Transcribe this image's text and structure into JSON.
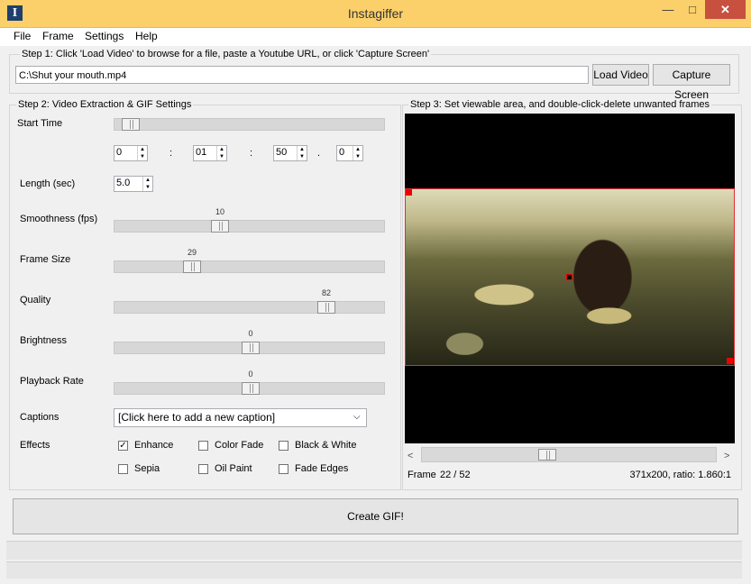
{
  "window": {
    "title": "Instagiffer",
    "icon_letter": "I",
    "minimize": "—",
    "maximize": "□",
    "close": "✕"
  },
  "menu": [
    "File",
    "Frame",
    "Settings",
    "Help"
  ],
  "step1": {
    "label": "Step 1: Click 'Load Video' to browse for a file, paste a Youtube URL, or click 'Capture Screen'",
    "file_path": "C:\\Shut your mouth.mp4",
    "load_video": "Load Video",
    "capture_screen": "Capture Screen"
  },
  "step2": {
    "label": "Step 2: Video Extraction & GIF Settings",
    "start_time": {
      "label": "Start Time",
      "position": 0.03,
      "hours": "0",
      "minutes": "01",
      "seconds": "50",
      "millis": "0",
      "sep1": ":",
      "sep2": ":",
      "sep3": "."
    },
    "length": {
      "label": "Length (sec)",
      "value": "5.0"
    },
    "sliders": [
      {
        "label": "Smoothness (fps)",
        "value": "10",
        "position": 0.38
      },
      {
        "label": "Frame Size",
        "value": "29",
        "position": 0.27
      },
      {
        "label": "Quality",
        "value": "82",
        "position": 0.8
      },
      {
        "label": "Brightness",
        "value": "0",
        "position": 0.5
      },
      {
        "label": "Playback Rate",
        "value": "0",
        "position": 0.5
      }
    ],
    "captions": {
      "label": "Captions",
      "value": "[Click here to add a new caption]"
    },
    "effects": {
      "label": "Effects",
      "items": [
        {
          "label": "Enhance",
          "checked": true
        },
        {
          "label": "Color Fade",
          "checked": false
        },
        {
          "label": "Black & White",
          "checked": false
        },
        {
          "label": "Sepia",
          "checked": false
        },
        {
          "label": "Oil Paint",
          "checked": false
        },
        {
          "label": "Fade Edges",
          "checked": false
        }
      ]
    }
  },
  "step3": {
    "label": "Step 3: Set viewable area, and double-click-delete unwanted frames",
    "scroll_left": "<",
    "scroll_right": ">",
    "scroll_position": 0.42,
    "frame_label": "Frame",
    "frame_value": "22 / 52",
    "dimensions": "371x200, ratio: 1.860:1"
  },
  "create_gif": "Create GIF!"
}
